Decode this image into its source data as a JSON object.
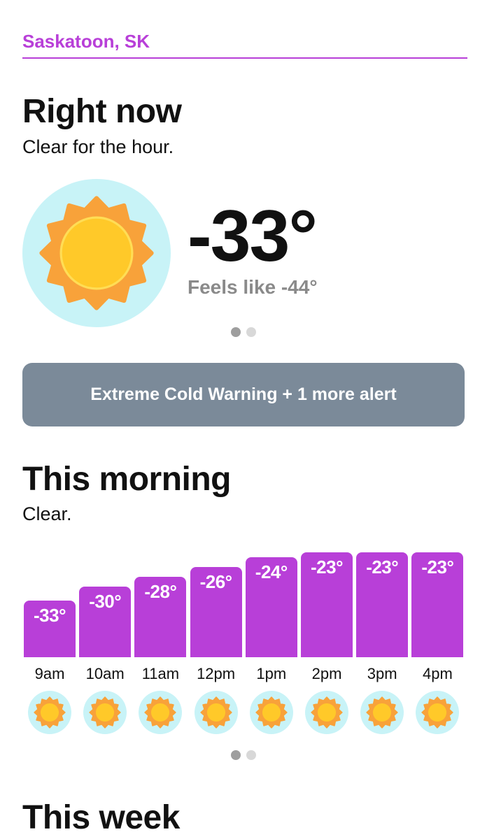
{
  "location": "Saskatoon, SK",
  "now": {
    "title": "Right now",
    "summary": "Clear for the hour.",
    "temperature": "-33°",
    "feels_like": "Feels like -44°",
    "icon": "sun-icon"
  },
  "alert": {
    "label": "Extreme Cold Warning + 1 more alert"
  },
  "morning": {
    "title": "This morning",
    "summary": "Clear.",
    "hours": [
      {
        "time": "9am",
        "temp": "-33°",
        "value": -33,
        "icon": "sun-icon"
      },
      {
        "time": "10am",
        "temp": "-30°",
        "value": -30,
        "icon": "sun-icon"
      },
      {
        "time": "11am",
        "temp": "-28°",
        "value": -28,
        "icon": "sun-icon"
      },
      {
        "time": "12pm",
        "temp": "-26°",
        "value": -26,
        "icon": "sun-icon"
      },
      {
        "time": "1pm",
        "temp": "-24°",
        "value": -24,
        "icon": "sun-icon"
      },
      {
        "time": "2pm",
        "temp": "-23°",
        "value": -23,
        "icon": "sun-icon"
      },
      {
        "time": "3pm",
        "temp": "-23°",
        "value": -23,
        "icon": "sun-icon"
      },
      {
        "time": "4pm",
        "temp": "-23°",
        "value": -23,
        "icon": "sun-icon"
      }
    ]
  },
  "week": {
    "title": "This week"
  },
  "pagers": {
    "now_active": 0,
    "morning_active": 0,
    "count": 2
  },
  "colors": {
    "accent": "#b83fd8",
    "alert_bg": "#7b8a99",
    "sun_bg": "#c8f3f7",
    "sun_rays": "#f8a23a",
    "sun_core": "#ffc929",
    "muted_text": "#8a8a8a"
  }
}
